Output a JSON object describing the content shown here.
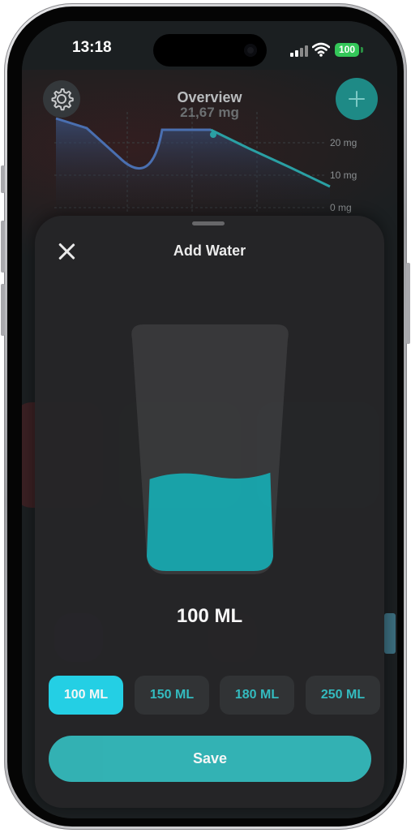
{
  "status_bar": {
    "time": "13:18",
    "battery": "100"
  },
  "background_app": {
    "title": "Overview",
    "subtitle": "21,67 mg",
    "chart_ticks": [
      "20 mg",
      "10 mg",
      "0 mg"
    ]
  },
  "sheet": {
    "title": "Add Water",
    "amount_label": "100 ML",
    "fill_fraction": 0.4,
    "presets": [
      {
        "label": "100 ML",
        "selected": true
      },
      {
        "label": "150 ML",
        "selected": false
      },
      {
        "label": "180 ML",
        "selected": false
      },
      {
        "label": "250 ML",
        "selected": false
      }
    ],
    "save_label": "Save"
  },
  "colors": {
    "accent": "#35b8ba",
    "selected_preset": "#25d7ec",
    "water": "#19a7ae",
    "sheet_bg": "#262628"
  },
  "icons": [
    "gear-icon",
    "plus-icon",
    "close-icon",
    "signal-icon",
    "wifi-icon",
    "battery-icon"
  ]
}
